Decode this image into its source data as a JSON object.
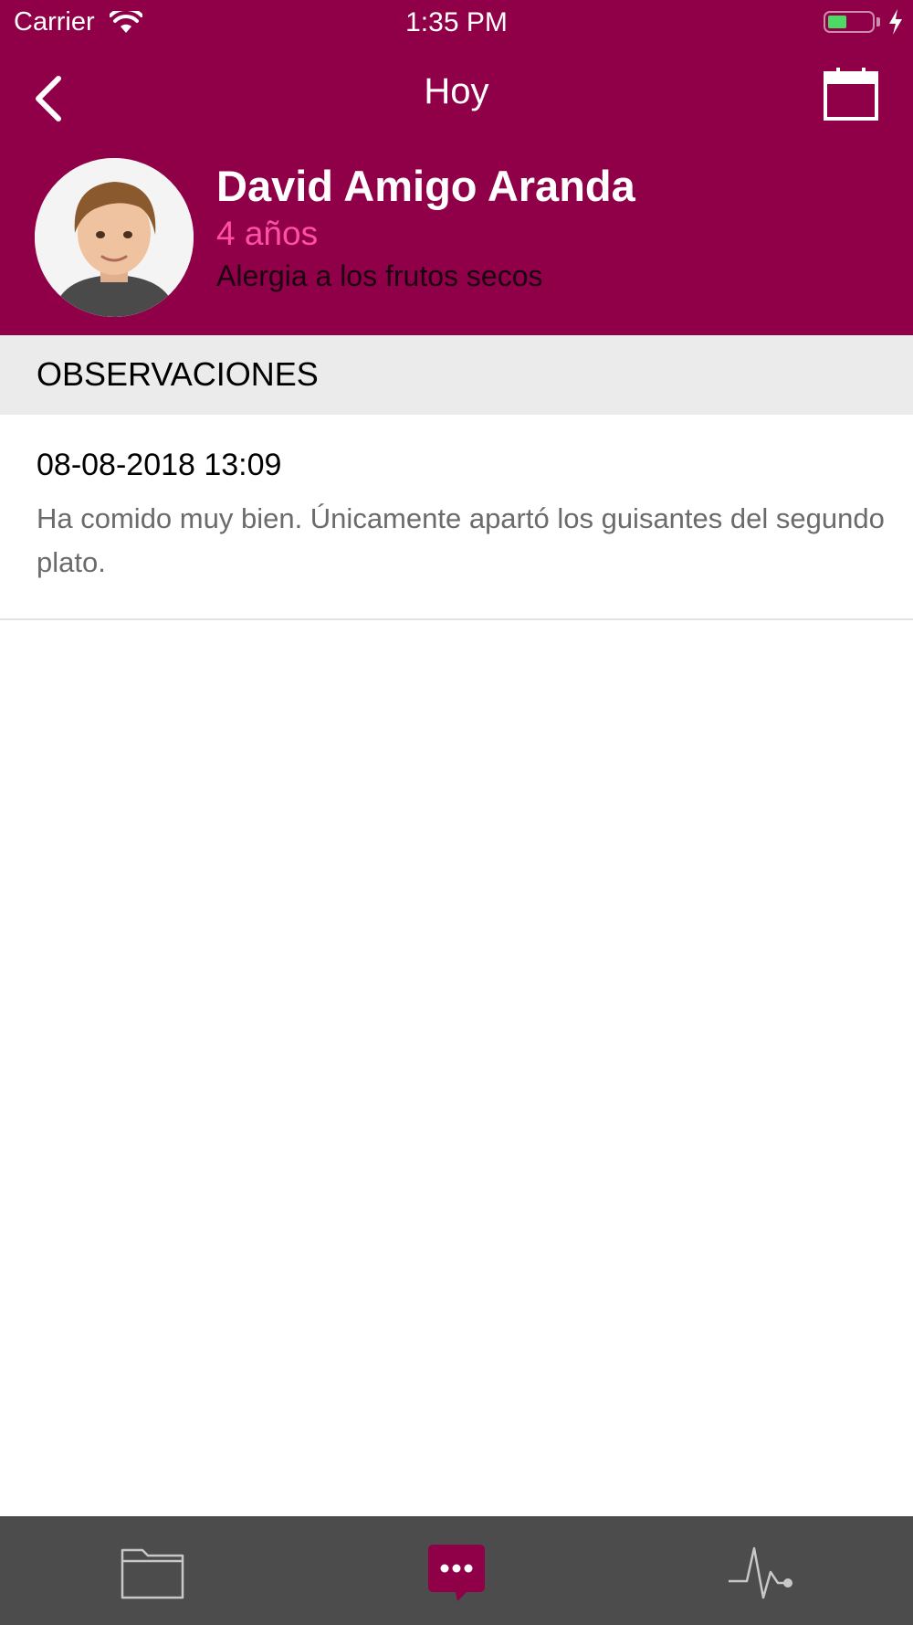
{
  "status_bar": {
    "carrier": "Carrier",
    "time": "1:35 PM"
  },
  "nav": {
    "title": "Hoy",
    "back_icon": "chevron-left-icon",
    "calendar_icon": "calendar-icon"
  },
  "profile": {
    "name": "David Amigo Aranda",
    "age": "4 años",
    "note": "Alergia a los frutos secos"
  },
  "section": {
    "title": "OBSERVACIONES"
  },
  "observations": [
    {
      "datetime": "08-08-2018 13:09",
      "text": "Ha comido muy bien. Únicamente apartó los guisantes del segundo plato."
    }
  ],
  "tabs": [
    {
      "icon": "folder-icon",
      "active": false
    },
    {
      "icon": "chat-bubble-icon",
      "active": true
    },
    {
      "icon": "pulse-icon",
      "active": false
    }
  ],
  "colors": {
    "brand": "#900048",
    "accent": "#ff4fa7",
    "tab_bar": "#4c4c4c"
  }
}
